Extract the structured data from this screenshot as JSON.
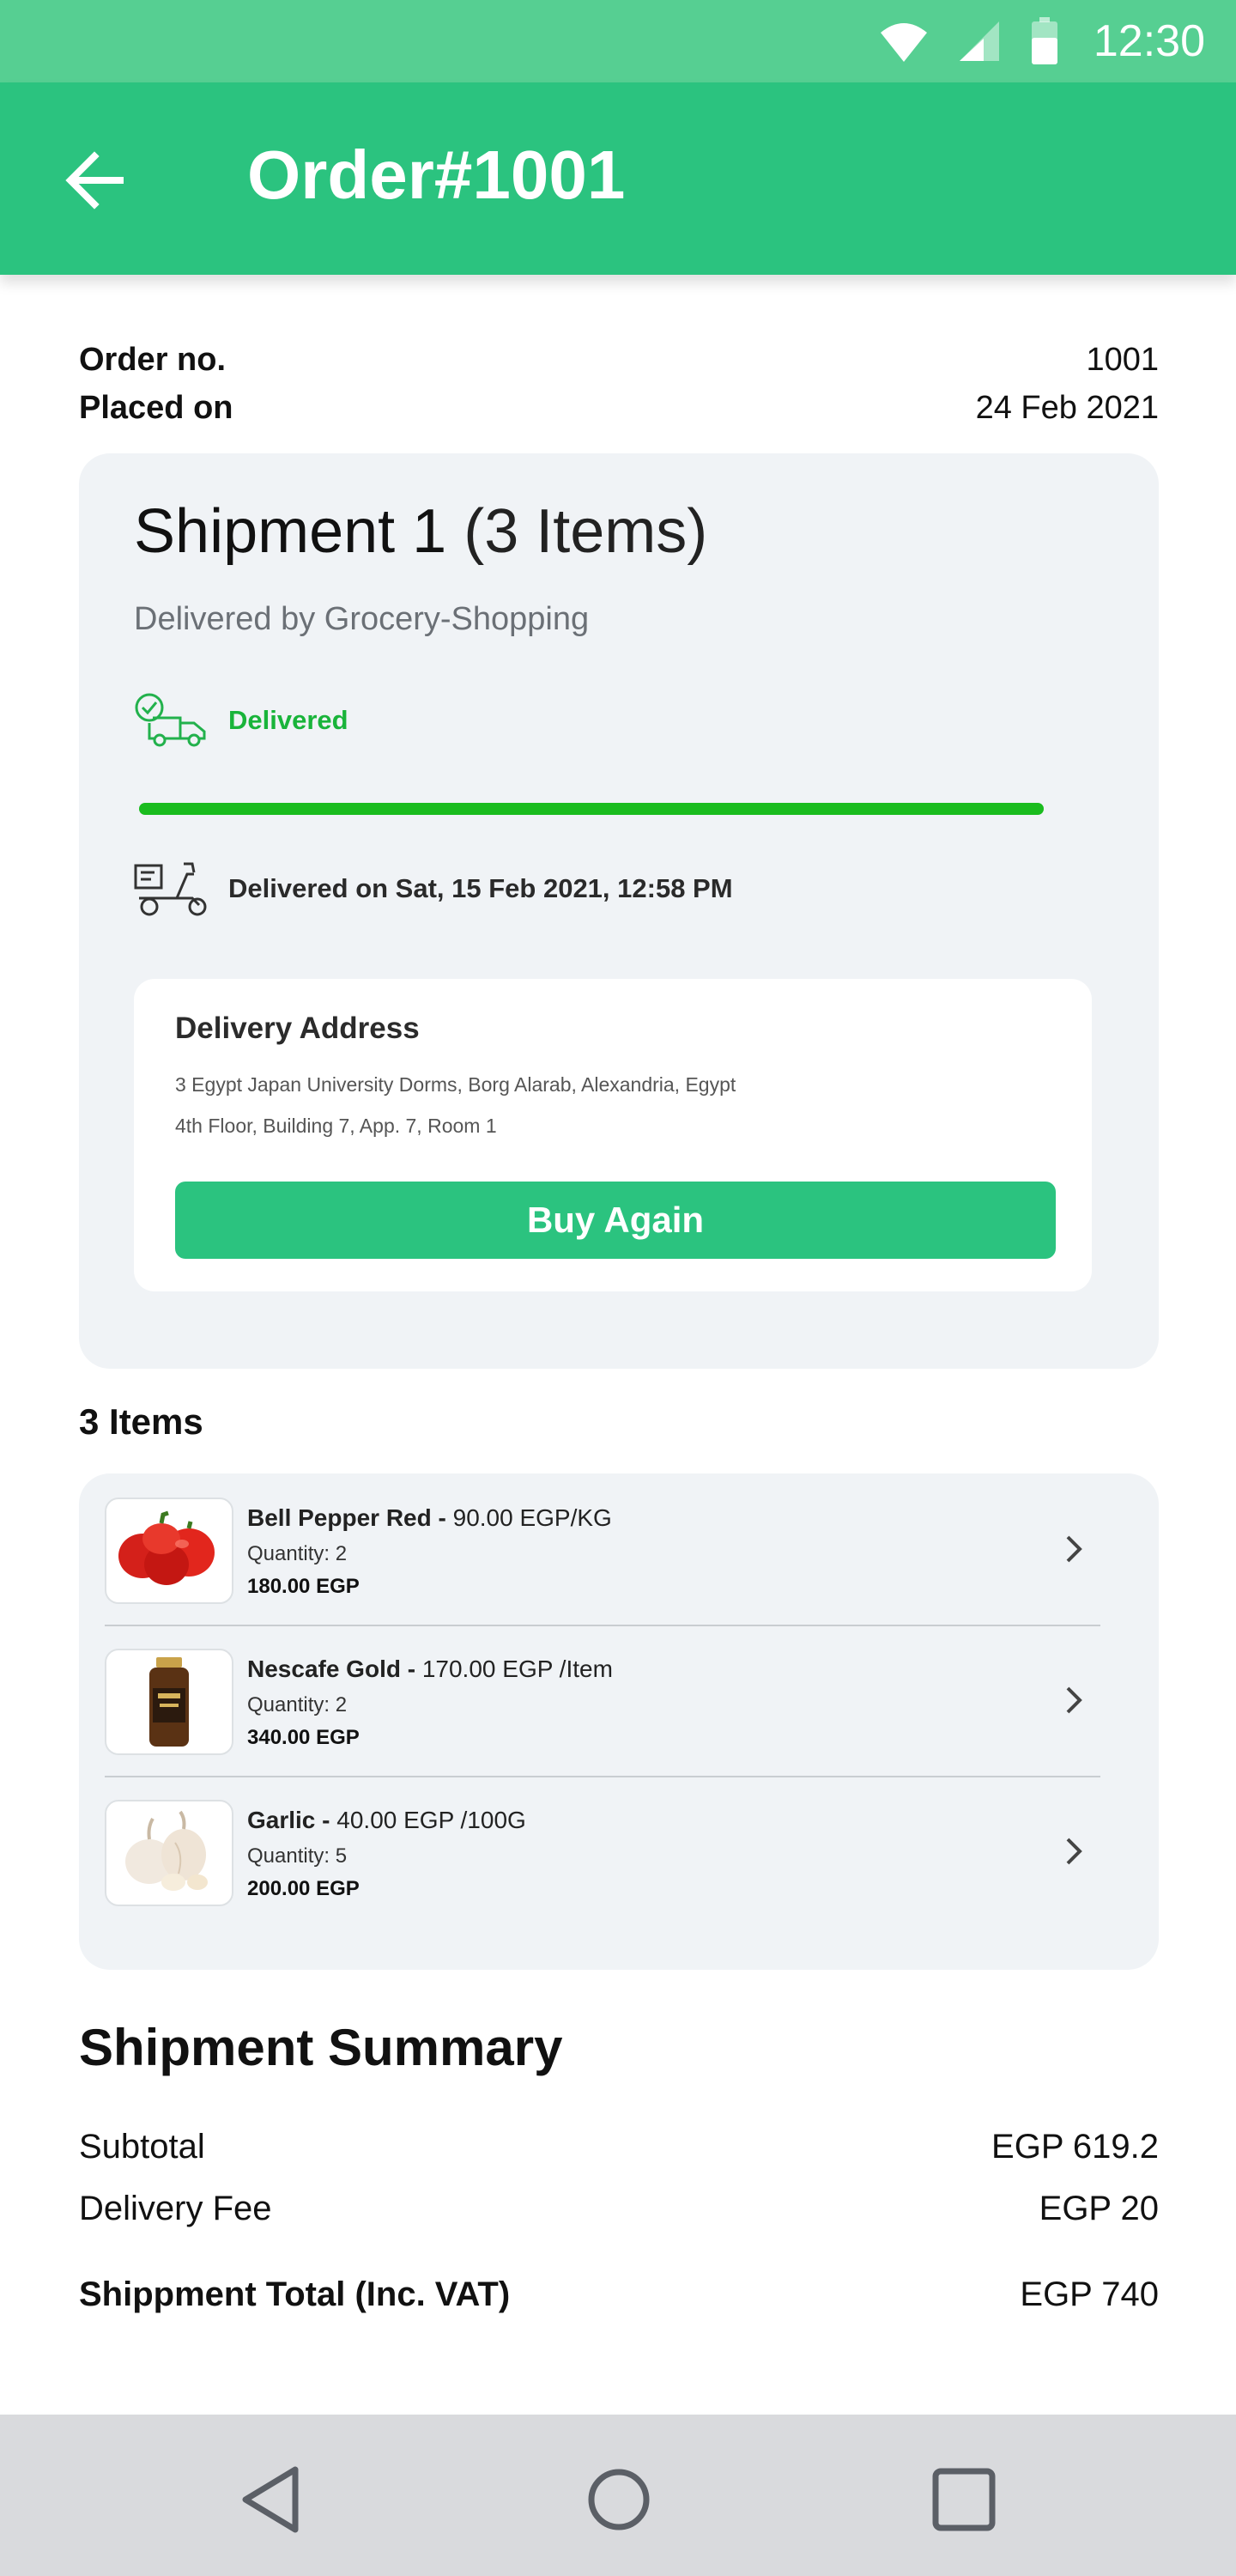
{
  "status_bar": {
    "time": "12:30",
    "icons": [
      "wifi-icon",
      "cellular-signal-icon",
      "battery-icon"
    ]
  },
  "app_bar": {
    "title": "Order#1001",
    "back_icon": "arrow-left-icon"
  },
  "order_meta": {
    "order_no_label": "Order no.",
    "order_no_value": "1001",
    "placed_on_label": "Placed on",
    "placed_on_value": "24 Feb 2021"
  },
  "shipment": {
    "title": "Shipment 1",
    "item_count": "(3 Items)",
    "delivered_by": "Delivered by Grocery-Shopping",
    "status": "Delivered",
    "status_icon": "delivery-truck-check-icon",
    "progress": 1.0,
    "delivered_on": "Delivered on Sat, 15 Feb 2021, 12:58 PM",
    "delivered_icon": "delivery-scooter-icon"
  },
  "delivery_address": {
    "title": "Delivery Address",
    "line1": "3 Egypt Japan University Dorms, Borg Alarab, Alexandria, Egypt",
    "line2": "4th Floor, Building 7, App. 7, Room 1",
    "buy_again_label": "Buy Again"
  },
  "items_heading": "3 Items",
  "items": [
    {
      "name": "Bell Pepper Red -",
      "price": " 90.00 EGP/KG",
      "quantity": "Quantity: 2",
      "total": "180.00 EGP",
      "image": "red-bell-pepper-image"
    },
    {
      "name": "Nescafe Gold -",
      "price": " 170.00 EGP /Item",
      "quantity": "Quantity: 2",
      "total": "340.00 EGP",
      "image": "nescafe-gold-jar-image"
    },
    {
      "name": "Garlic -",
      "price": " 40.00 EGP /100G",
      "quantity": "Quantity: 5",
      "total": "200.00 EGP",
      "image": "garlic-image"
    }
  ],
  "summary": {
    "title": "Shipment Summary",
    "subtotal_label": "Subtotal",
    "subtotal_value": "EGP 619.2",
    "delivery_fee_label": "Delivery Fee",
    "delivery_fee_value": "EGP 20",
    "total_label": "Shippment Total (Inc. VAT)",
    "total_value": "EGP 740"
  },
  "nav_bar": {
    "buttons": [
      "back-triangle-icon",
      "home-circle-icon",
      "recents-square-icon"
    ]
  },
  "colors": {
    "primary": "#2bc37f",
    "status_bar": "#56cf92",
    "delivered_green": "#19b43a",
    "card_bg": "#f0f3f6"
  }
}
